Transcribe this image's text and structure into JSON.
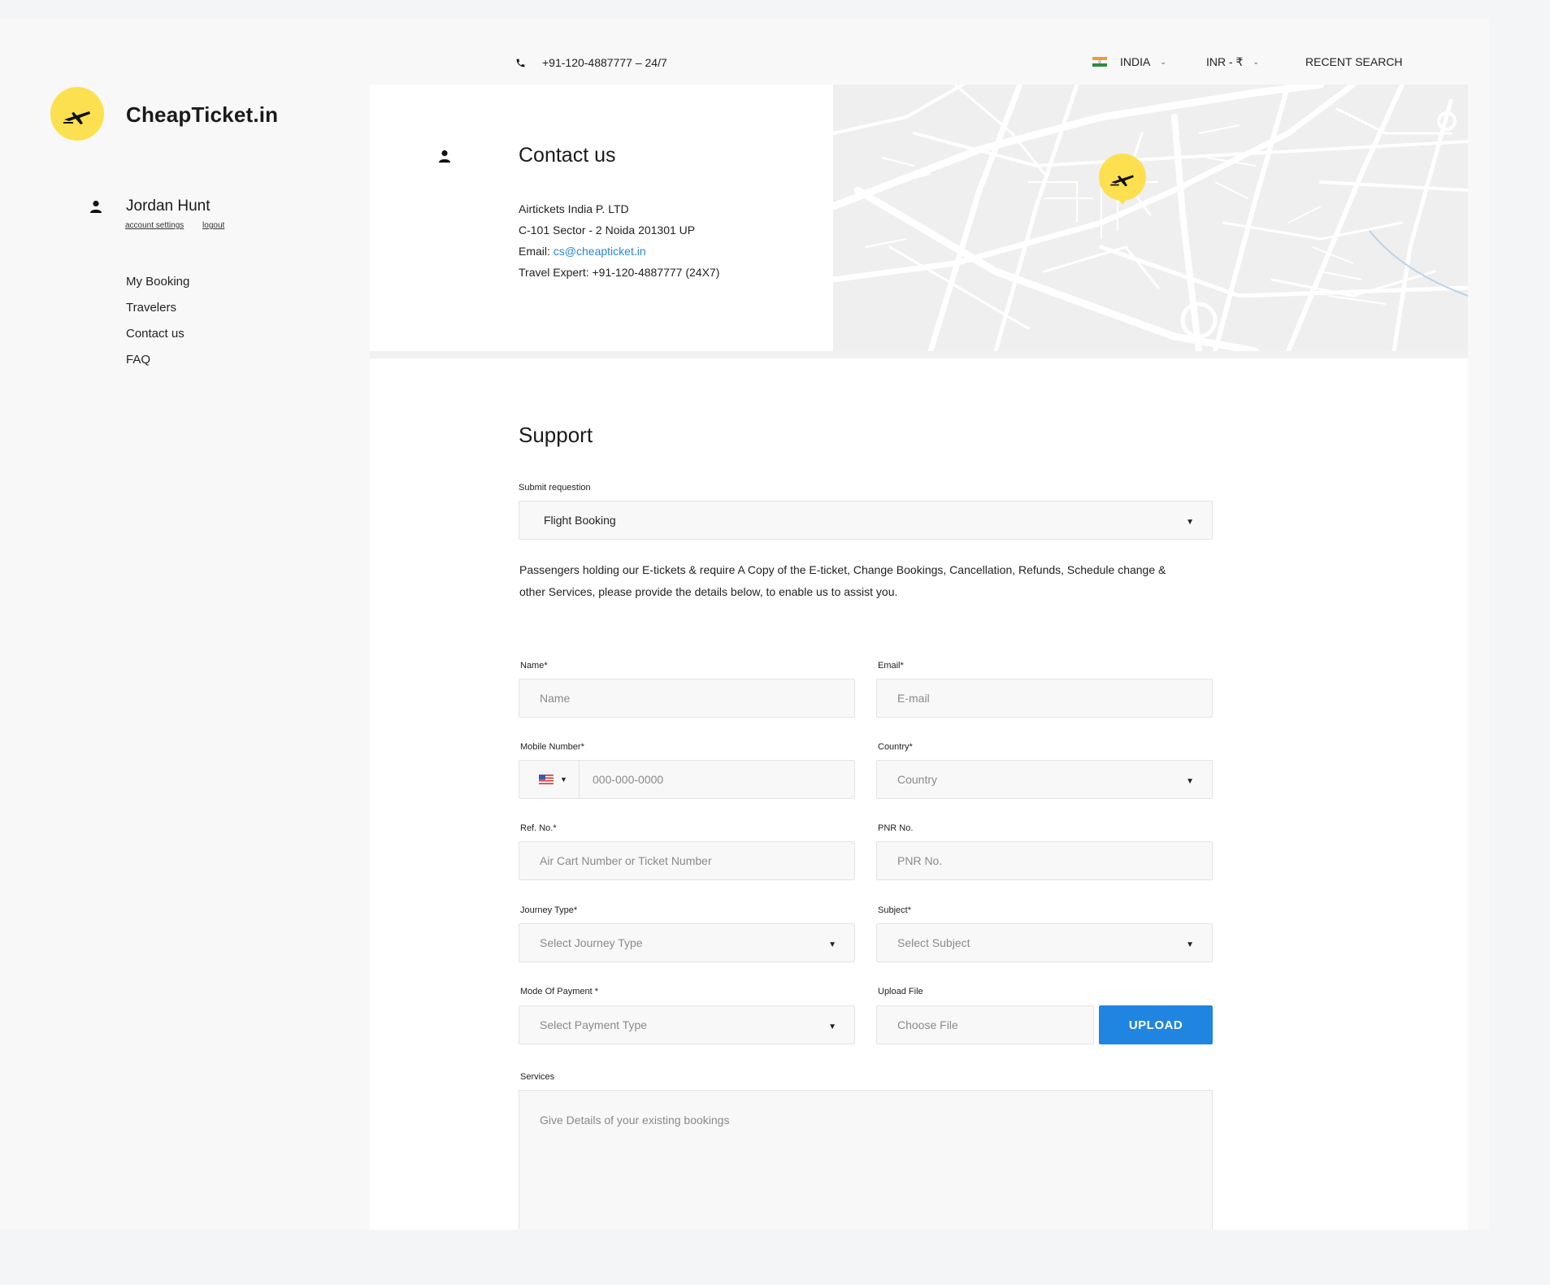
{
  "topbar": {
    "phone": "+91-120-4887777  –  24/7",
    "country": "INDIA",
    "currency": "INR - ₹",
    "recent_search": "RECENT SEARCH"
  },
  "brand": {
    "name": "CheapTicket.in"
  },
  "user": {
    "name": "Jordan Hunt",
    "account_settings": "account settings",
    "logout": "logout"
  },
  "sidenav": {
    "items": [
      {
        "label": "My Booking"
      },
      {
        "label": "Travelers"
      },
      {
        "label": "Contact us"
      },
      {
        "label": "FAQ"
      }
    ]
  },
  "contact": {
    "title": "Contact us",
    "company": "Airtickets India P. LTD",
    "address": "C-101 Sector - 2 Noida 201301 UP",
    "email_label": "Email: ",
    "email": "cs@cheapticket.in",
    "expert": "Travel Expert: +91-120-4887777 (24X7)"
  },
  "support": {
    "title": "Support",
    "request_label": "Submit requestion",
    "request_value": "Flight Booking",
    "description": "Passengers holding our E-tickets & require A Copy of the E-ticket, Change Bookings, Cancellation, Refunds, Schedule change & other Services, please provide the details below, to enable us to assist you.",
    "fields": {
      "name_label": "Name*",
      "name_placeholder": "Name",
      "email_label": "Email*",
      "email_placeholder": "E-mail",
      "mobile_label": "Mobile Number*",
      "mobile_placeholder": "000-000-0000",
      "country_label": "Country*",
      "country_placeholder": "Country",
      "ref_label": "Ref. No.*",
      "ref_placeholder": "Air Cart Number or Ticket Number",
      "pnr_label": "PNR No.",
      "pnr_placeholder": "PNR No.",
      "journey_label": "Journey Type*",
      "journey_placeholder": "Select Journey Type",
      "subject_label": "Subject*",
      "subject_placeholder": "Select Subject",
      "payment_label": "Mode Of Payment *",
      "payment_placeholder": "Select Payment Type",
      "upload_label": "Upload File",
      "upload_placeholder": "Choose File",
      "upload_button": "UPLOAD",
      "services_label": "Services",
      "services_placeholder": "Give Details of your existing bookings"
    }
  },
  "colors": {
    "brand_yellow": "#fde050",
    "accent_blue": "#2085e0",
    "link_blue": "#2a86d9"
  }
}
